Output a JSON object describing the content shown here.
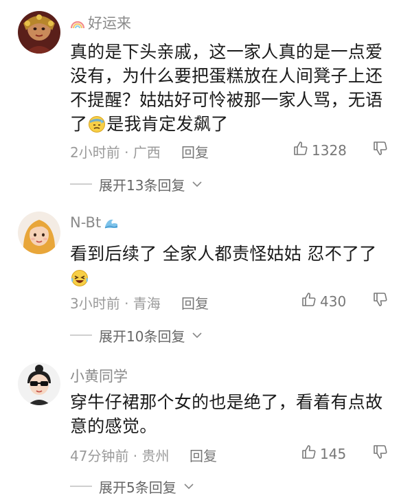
{
  "comments": [
    {
      "username": "好运来",
      "username_deco": "rainbow-icon",
      "text_parts": [
        "真的是下头亲戚，这一家人真的是一点爱没有，为什么要把蛋糕放在人间凳子上还不提醒？姑姑好可怜被那一家人骂，无语了",
        "是我肯定发飙了"
      ],
      "inline_emoji": "sweat-face-emoji",
      "time_location": "2小时前 · 广西",
      "reply_label": "回复",
      "likes": "1328",
      "expand_label": "展开13条回复"
    },
    {
      "username": "N-Bt",
      "username_deco": "wave-icon",
      "text_parts": [
        "看到后续了 全家人都责怪姑姑 忍不了了"
      ],
      "inline_emoji": "laughing-face-emoji",
      "time_location": "3小时前 · 青海",
      "reply_label": "回复",
      "likes": "430",
      "expand_label": "展开10条回复"
    },
    {
      "username": "小黄同学",
      "username_deco": "",
      "text_parts": [
        "穿牛仔裙那个女的也是绝了，看着有点故意的感觉。"
      ],
      "inline_emoji": "",
      "time_location": "47分钟前 · 贵州",
      "reply_label": "回复",
      "likes": "145",
      "expand_label": "展开5条回复"
    }
  ],
  "colors": {
    "text": "#1a1a1a",
    "muted": "#9a9a9a",
    "divider": "#cfcfcf"
  }
}
